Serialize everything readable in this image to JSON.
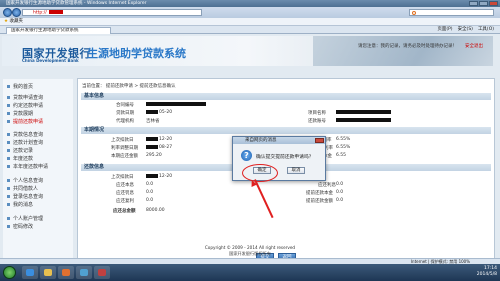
{
  "browser": {
    "window_title": "国家开发银行生源地助学贷款管理系统 - Windows Internet Explorer",
    "address_url": "http://",
    "favorites_label": "收藏夹",
    "tab_label": "国家开发银行生源地助学贷款系统",
    "commands": [
      "页面(P)",
      "安全(S)",
      "工具(O)"
    ]
  },
  "header": {
    "bank_name_cn": "国家开发银行",
    "bank_name_en": "China Development Bank",
    "system_title": "生源地助学贷款系统",
    "notice": "请您注意：我的记录，请务必及时处理待办记录！",
    "exit_link": "安全退出"
  },
  "sidebar": {
    "items": [
      {
        "label": "我的首页",
        "active": false
      },
      {
        "label": "贷款申请查询",
        "active": false
      },
      {
        "label": "约定还款申请",
        "active": false
      },
      {
        "label": "贷款展期",
        "active": false
      },
      {
        "label": "提前还款申请",
        "active": true
      },
      {
        "label": "贷款信息查询",
        "active": false
      },
      {
        "label": "还款计划查询",
        "active": false
      },
      {
        "label": "还款记录",
        "active": false
      },
      {
        "label": "年度还款",
        "active": false
      },
      {
        "label": "本年度还款申请",
        "active": false
      },
      {
        "label": "个人信息查询",
        "active": false
      },
      {
        "label": "共同借款人",
        "active": false
      },
      {
        "label": "登录信息查询",
        "active": false
      },
      {
        "label": "我的消息",
        "active": false
      },
      {
        "label": "个人账户管理",
        "active": false
      },
      {
        "label": "密码修改",
        "active": false
      }
    ]
  },
  "main": {
    "breadcrumb": "当前位置： 提前还款申请 > 提前还款信息确认",
    "sections": {
      "basic": "基本信息",
      "current": "本期情况",
      "repay": "还款信息"
    },
    "basic_fields": [
      {
        "label": "合同编号",
        "value": ""
      },
      {
        "label": "贷款日期",
        "value": "05-20"
      },
      {
        "label": "代理机构",
        "value": "吉林省"
      },
      {
        "label": "项目名称",
        "value": ""
      },
      {
        "label": "还款账号",
        "value": ""
      }
    ],
    "current_fields": [
      {
        "label": "上次扣款日",
        "value": "12-20"
      },
      {
        "label": "利率调整日期",
        "value": "08-27"
      },
      {
        "label": "本期应还金额",
        "value": "295.20"
      },
      {
        "label": "年利率",
        "value": "6.55%"
      },
      {
        "label": "实际执行利率",
        "value": "6.55%"
      },
      {
        "label": "应还本金",
        "value": "6.55"
      }
    ],
    "repay_fields": [
      {
        "label": "上次扣款日",
        "value": "12-20"
      },
      {
        "label": "应还本息",
        "value": "0.0"
      },
      {
        "label": "应还罚息",
        "value": "0.0"
      },
      {
        "label": "应还复利",
        "value": "0.0"
      },
      {
        "label": "应还利息",
        "value": "0.0"
      },
      {
        "label": "提前还款本金",
        "value": "0.0"
      },
      {
        "label": "提前还款金额",
        "value": "0.0"
      },
      {
        "label": "应还总金额",
        "value": "8000.00"
      }
    ],
    "buttons": {
      "confirm": "提交",
      "back": "返回"
    },
    "footer_line1": "Copyright © 2009 - 2014 All right reserved",
    "footer_line2": "国家开发银行版权所有"
  },
  "dialog": {
    "title": "来自网页的消息",
    "message": "确认提交提前还款申请吗？",
    "ok": "确定",
    "cancel": "取消"
  },
  "statusbar": {
    "zone": "Internet | 保护模式: 禁用",
    "zoom": "100%"
  },
  "taskbar": {
    "time": "17:14",
    "date": "2014/5/8"
  }
}
